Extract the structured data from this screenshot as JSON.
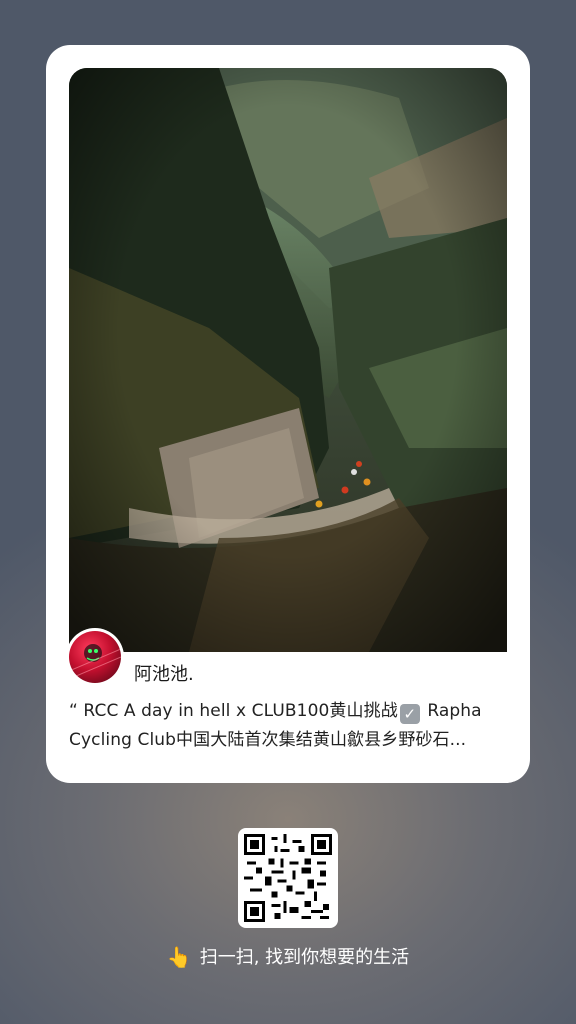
{
  "post": {
    "username": "阿池池.",
    "text_line1_pre": "“ RCC A day in hell x CLUB100黄山挑战",
    "text_line1_post": " Rapha",
    "text_line2": "Cycling Club中国大陆首次集结黄山歙县乡野砂石...",
    "check_icon": "✓"
  },
  "share": {
    "hand_icon": "👆",
    "hint": "扫一扫, 找到你想要的生活"
  },
  "colors": {
    "background": "#5e6470",
    "card": "#ffffff",
    "avatar_accent": "#c4102f",
    "check_badge": "#9aa0a6"
  }
}
